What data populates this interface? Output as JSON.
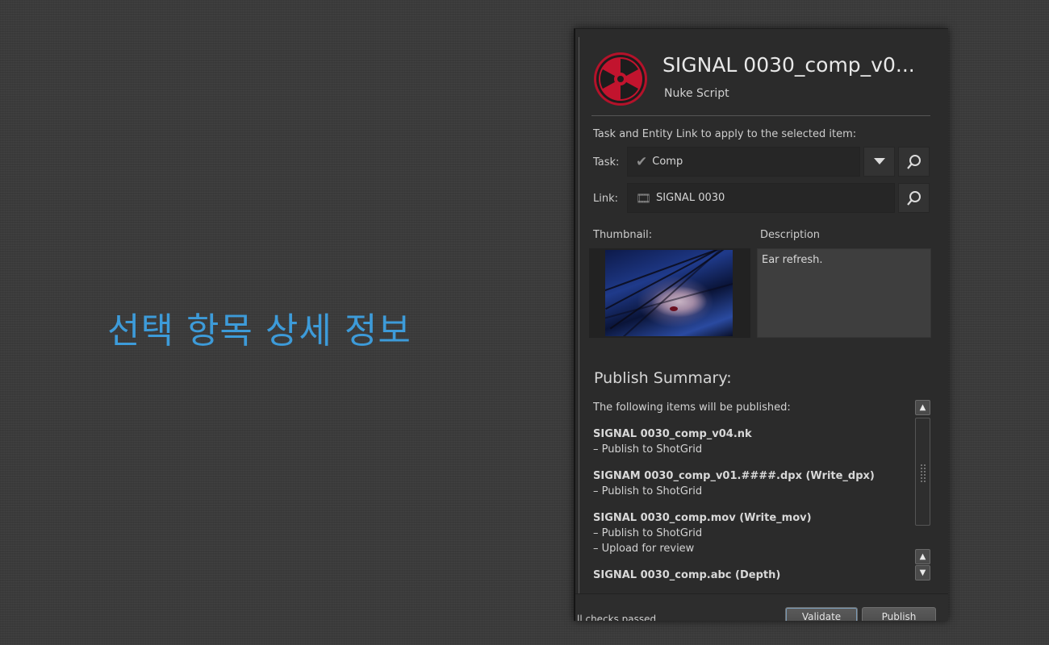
{
  "caption": "선택 항목 상세 정보",
  "header": {
    "title": "SIGNAL 0030_comp_v0...",
    "subtitle": "Nuke Script"
  },
  "instruction": "Task and Entity Link to apply to the selected item:",
  "task": {
    "label": "Task:",
    "icon": "checkmark-icon",
    "value": "Comp"
  },
  "link": {
    "label": "Link:",
    "icon": "film-icon",
    "value": "SIGNAL 0030"
  },
  "thumbnail": {
    "label": "Thumbnail:"
  },
  "description": {
    "label": "Description",
    "value": "Ear refresh."
  },
  "summary": {
    "title": "Publish Summary:",
    "intro": "The following items will be published:",
    "items": [
      {
        "name": "SIGNAL 0030_comp_v04.nk",
        "actions": [
          "– Publish to ShotGrid"
        ]
      },
      {
        "name": "SIGNAM 0030_comp_v01.####.dpx (Write_dpx)",
        "actions": [
          "– Publish to ShotGrid"
        ]
      },
      {
        "name": "SIGNAL 0030_comp.mov (Write_mov)",
        "actions": [
          "– Publish to ShotGrid",
          "– Upload for review"
        ]
      },
      {
        "name": "SIGNAL 0030_comp.abc (Depth)",
        "actions": []
      }
    ]
  },
  "footer": {
    "status": "ll checks passed.",
    "validate_label": "Validate",
    "publish_label": "Publish"
  },
  "colors": {
    "caption": "#3d9bd9",
    "nuke_red": "#b4122a"
  }
}
